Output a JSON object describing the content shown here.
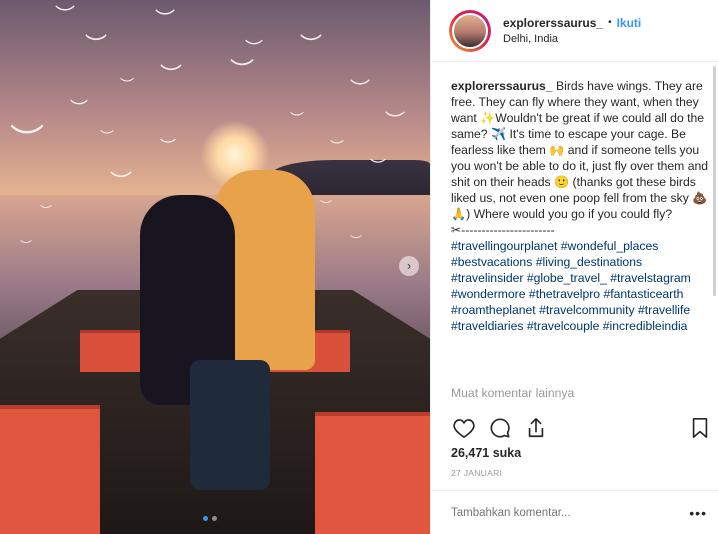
{
  "post": {
    "nav_arrow": "›",
    "carousel_dots": 2,
    "carousel_active": 0
  },
  "header": {
    "username": "explorerssaurus_",
    "separator": "•",
    "follow_label": "Ikuti",
    "location": "Delhi, India"
  },
  "caption": {
    "username": "explorerssaurus_",
    "text": "Birds have wings. They are free. They can fly where they want, when they want ✨Wouldn't be great if we could all do the same? ✈️ It's time to escape your cage. Be fearless like them 🙌 and if someone tells you you won't be able to do it, just fly over them and shit on their heads 🙂 (thanks got these birds liked us, not even one poop fell from the sky 💩 🙏) Where would you go if you could fly?",
    "divider": "✂-----------------------",
    "hashtags": [
      "#travellingourplanet",
      "#wondeful_places",
      "#bestvacations",
      "#living_destinations",
      "#travelinsider",
      "#globe_travel_",
      "#travelstagram",
      "#wondermore",
      "#thetravelpro",
      "#fantasticearth",
      "#roamtheplanet",
      "#travelcommunity",
      "#travellife",
      "#traveldiaries",
      "#travelcouple",
      "#incredibleindia"
    ]
  },
  "comments": {
    "more_label": "Muat komentar lainnya"
  },
  "actions": {
    "like_icon": "heart-icon",
    "comment_icon": "comment-icon",
    "share_icon": "share-icon",
    "save_icon": "bookmark-icon"
  },
  "likes": {
    "count_label": "26,471 suka"
  },
  "date": {
    "label": "27 JANUARI"
  },
  "comment_box": {
    "placeholder": "Tambahkan komentar...",
    "more": "•••"
  },
  "colors": {
    "link": "#3897f0",
    "hashtag": "#003569",
    "muted": "#999999",
    "text": "#262626"
  }
}
